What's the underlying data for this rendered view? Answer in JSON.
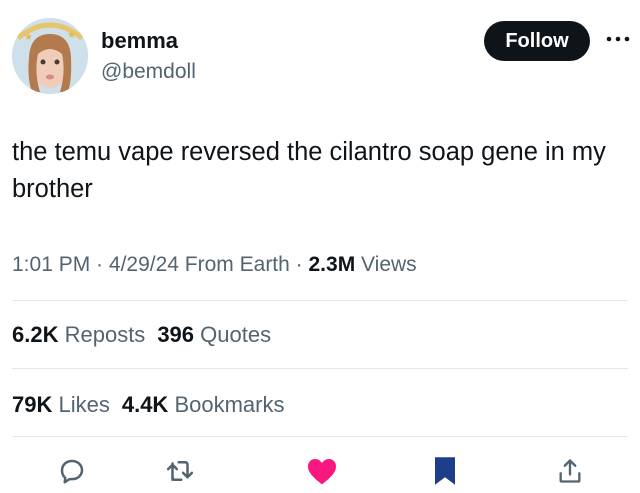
{
  "user": {
    "name": "bemma",
    "handle": "@bemdoll",
    "follow_label": "Follow"
  },
  "tweet": {
    "text": "the temu vape reversed the cilantro soap gene in my brother"
  },
  "meta": {
    "time": "1:01 PM",
    "sep1": " · ",
    "date": "4/29/24",
    "source": " From Earth",
    "sep2": " · ",
    "views_count": "2.3M",
    "views_label": " Views"
  },
  "stats": {
    "reposts_count": "6.2K",
    "reposts_label": " Reposts",
    "quotes_count": "396",
    "quotes_label": " Quotes",
    "likes_count": "79K",
    "likes_label": " Likes",
    "bookmarks_count": "4.4K",
    "bookmarks_label": " Bookmarks"
  },
  "colors": {
    "like": "#f91880",
    "bookmark": "#1d3f8a",
    "icon": "#536471",
    "follow_bg": "#0f1419"
  },
  "icons": [
    "reply-icon",
    "repost-icon",
    "like-icon",
    "bookmark-icon",
    "share-icon"
  ]
}
